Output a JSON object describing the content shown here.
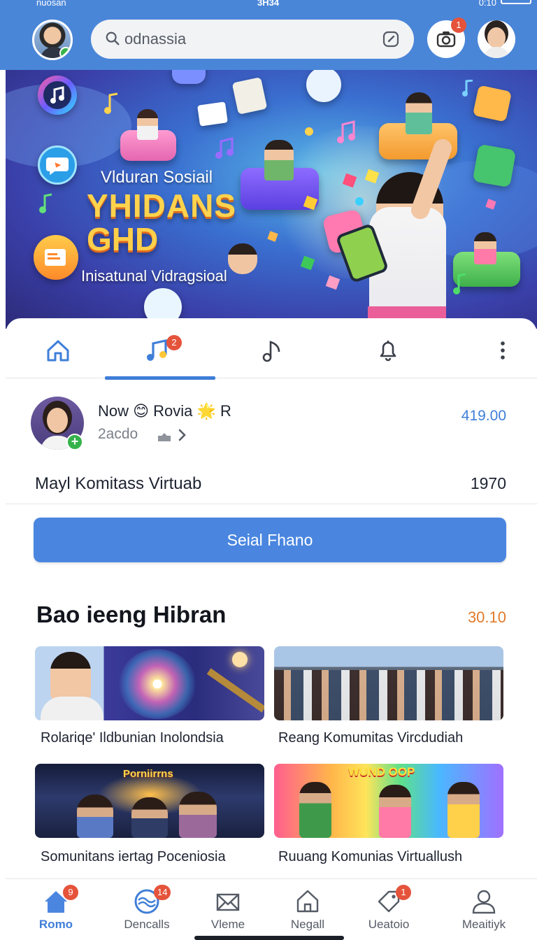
{
  "status_bar": {
    "carrier": "nuosan",
    "time": "3H34",
    "right": "0:10"
  },
  "search": {
    "value": "odnassia"
  },
  "camera": {
    "badge": "1"
  },
  "hero": {
    "line1": "Vlduran Sosiail",
    "line2": "YHIDANS",
    "line3": "GHD",
    "line4": "Inisatunal Vidragsioal"
  },
  "tabs": {
    "music_badge": "2"
  },
  "post": {
    "name": "Now 😊 Rovia 🌟 R",
    "sub": "2acdo",
    "price": "419.00",
    "title": "Mayl Komitass Virtuab",
    "count": "1970"
  },
  "main_button": {
    "label": "Seial Fhano"
  },
  "section": {
    "title": "Bao ieeng Hibran",
    "count": "30.10",
    "items": [
      {
        "caption": "Rolariqe' Ildbunian Inolondsia"
      },
      {
        "caption": "Reang Komumitas Vircdudiah"
      },
      {
        "caption": "Somunitans iertag Poceniosia",
        "overlay": "Porniirrns"
      },
      {
        "caption": "Ruuang Komunias Virtuallush",
        "overlay": "WUND OOP"
      }
    ]
  },
  "bottom_nav": [
    {
      "label": "Romo",
      "badge": "9",
      "icon": "home-icon"
    },
    {
      "label": "Dencalls",
      "badge": "14",
      "icon": "wave-icon"
    },
    {
      "label": "Vleme",
      "badge": "",
      "icon": "mail-icon"
    },
    {
      "label": "Negall",
      "badge": "",
      "icon": "house-outline-icon"
    },
    {
      "label": "Ueatoio",
      "badge": "1",
      "icon": "tag-icon"
    },
    {
      "label": "Meaitiyk",
      "badge": "",
      "icon": "user-icon"
    }
  ],
  "colors": {
    "accent": "#3f7ed8",
    "top_bar": "#4a86d8",
    "badge": "#e5533b",
    "count_orange": "#e07a2b"
  }
}
